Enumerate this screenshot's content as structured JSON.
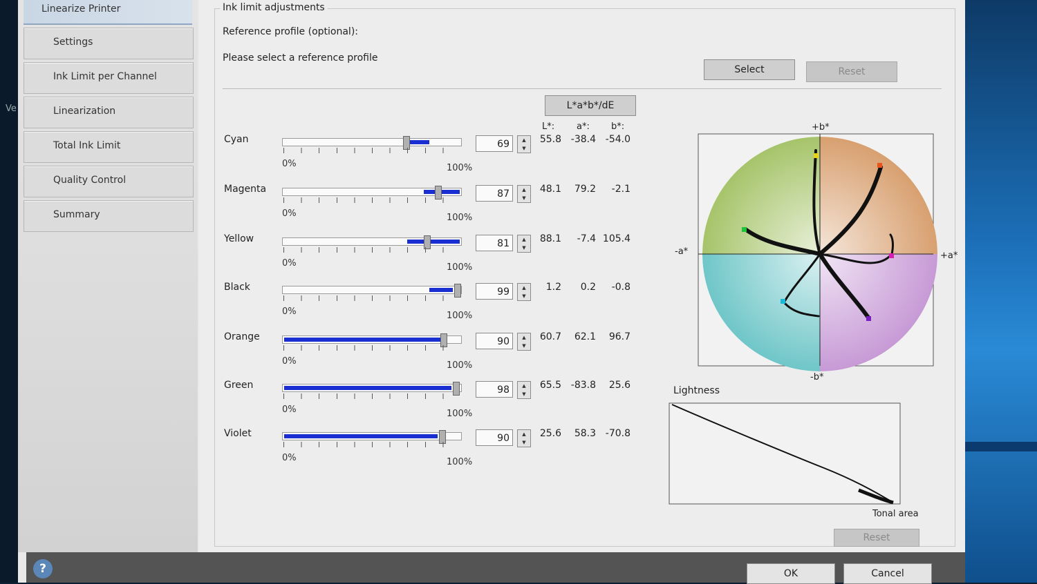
{
  "sidebar": {
    "header": "Linearize Printer",
    "items": [
      {
        "label": "Settings"
      },
      {
        "label": "Ink Limit per Channel"
      },
      {
        "label": "Linearization"
      },
      {
        "label": "Total Ink Limit"
      },
      {
        "label": "Quality Control"
      },
      {
        "label": "Summary"
      }
    ]
  },
  "group": {
    "title": "Ink limit adjustments",
    "reference_label": "Reference profile (optional):",
    "reference_value": "Please select a reference profile",
    "select_label": "Select",
    "reset_label": "Reset"
  },
  "lab_button": "L*a*b*/dE",
  "lab_headers": {
    "L": "L*:",
    "a": "a*:",
    "b": "b*:"
  },
  "slider_min": "0%",
  "slider_max": "100%",
  "channels": [
    {
      "name": "Cyan",
      "value": "69",
      "percent": 69,
      "L": "55.8",
      "a": "-38.4",
      "b": "-54.0"
    },
    {
      "name": "Magenta",
      "value": "87",
      "percent": 87,
      "L": "48.1",
      "a": "79.2",
      "b": "-2.1"
    },
    {
      "name": "Yellow",
      "value": "81",
      "percent": 81,
      "L": "88.1",
      "a": "-7.4",
      "b": "105.4"
    },
    {
      "name": "Black",
      "value": "99",
      "percent": 99,
      "L": "1.2",
      "a": "0.2",
      "b": "-0.8"
    },
    {
      "name": "Orange",
      "value": "90",
      "percent": 90,
      "L": "60.7",
      "a": "62.1",
      "b": "96.7"
    },
    {
      "name": "Green",
      "value": "98",
      "percent": 98,
      "L": "65.5",
      "a": "-83.8",
      "b": "25.6"
    },
    {
      "name": "Violet",
      "value": "90",
      "percent": 90,
      "L": "25.6",
      "a": "58.3",
      "b": "-70.8"
    }
  ],
  "colour_chart": {
    "plus_b": "+b*",
    "minus_b": "-b*",
    "plus_a": "+a*",
    "minus_a": "-a*"
  },
  "lightness_chart": {
    "title": "Lightness",
    "xlabel": "Tonal area",
    "reset_label": "Reset"
  },
  "footer": {
    "ok_label": "OK",
    "cancel_label": "Cancel",
    "help": "?"
  },
  "desktop_edge_text": "Ve",
  "colors": {
    "slider_fill": "#1a2fd1",
    "cyan_marker": "#19b8d6",
    "magenta_marker": "#d41fb0",
    "yellow_marker": "#e6d21a",
    "orange_marker": "#e8541c",
    "green_marker": "#1fc43a",
    "violet_marker": "#7a1fbf"
  }
}
